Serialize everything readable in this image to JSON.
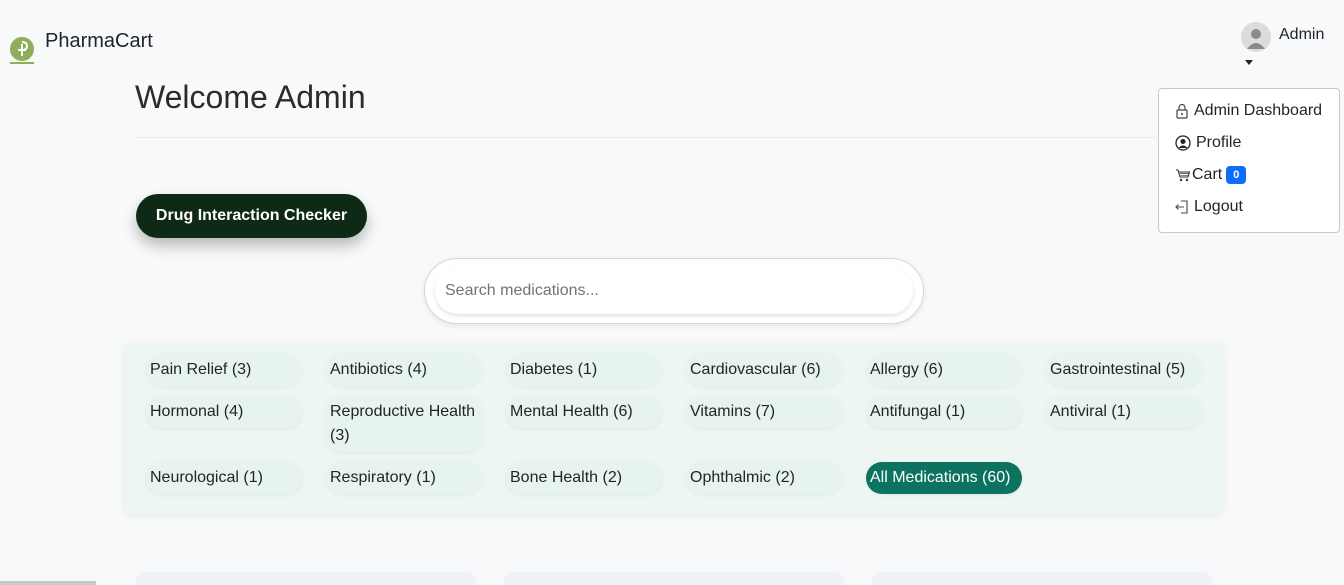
{
  "brand": {
    "name": "PharmaCart",
    "logo_icon": "pharmacy-logo-icon"
  },
  "user": {
    "name": "Admin",
    "avatar_icon": "user-avatar-icon"
  },
  "dropdown": {
    "items": [
      {
        "label": "Admin Dashboard",
        "icon": "lock-icon"
      },
      {
        "label": "Profile",
        "icon": "user-circle-icon"
      },
      {
        "label": "Cart",
        "icon": "cart-icon",
        "badge": "0"
      },
      {
        "label": "Logout",
        "icon": "logout-icon"
      }
    ]
  },
  "page": {
    "title": "Welcome Admin"
  },
  "checker_button": {
    "label": "Drug Interaction Checker"
  },
  "search": {
    "placeholder": "Search medications...",
    "value": ""
  },
  "categories": [
    "Pain Relief (3)",
    "Antibiotics (4)",
    "Diabetes (1)",
    "Cardiovascular (6)",
    "Allergy (6)",
    "Gastrointestinal (5)",
    "Hormonal (4)",
    "Reproductive Health (3)",
    "Mental Health (6)",
    "Vitamins (7)",
    "Antifungal (1)",
    "Antiviral (1)",
    "Neurological (1)",
    "Respiratory (1)",
    "Bone Health (2)",
    "Ophthalmic (2)",
    "All Medications (60)"
  ],
  "active_category": "All Medications (60)",
  "colors": {
    "accent": "#0b7360",
    "button_dark": "#0f2a14",
    "badge": "#0d6efd"
  }
}
